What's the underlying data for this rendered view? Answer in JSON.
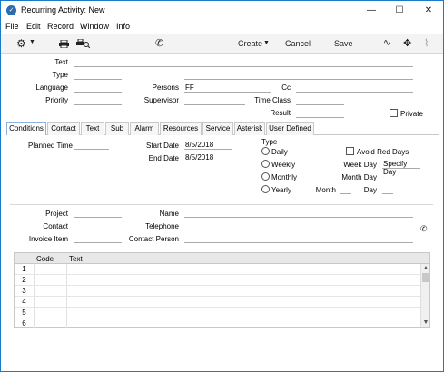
{
  "window": {
    "title": "Recurring Activity: New"
  },
  "menu": [
    "File",
    "Edit",
    "Record",
    "Window",
    "Info"
  ],
  "toolbar": {
    "create": "Create",
    "cancel": "Cancel",
    "save": "Save"
  },
  "form": {
    "text_label": "Text",
    "type_label": "Type",
    "language_label": "Language",
    "priority_label": "Priority",
    "persons_label": "Persons",
    "persons_value": "FF",
    "supervisor_label": "Supervisor",
    "cc_label": "Cc",
    "timeclass_label": "Time Class",
    "result_label": "Result",
    "private_label": "Private"
  },
  "tabs": [
    "Conditions",
    "Contact",
    "Text",
    "Sub",
    "Alarm",
    "Resources",
    "Service",
    "Asterisk",
    "User Defined"
  ],
  "conditions": {
    "planned_time_label": "Planned Time",
    "start_date_label": "Start Date",
    "start_date": "8/5/2018",
    "end_date_label": "End Date",
    "end_date": "8/5/2018",
    "type_label": "Type",
    "daily": "Daily",
    "weekly": "Weekly",
    "monthly": "Monthly",
    "yearly": "Yearly",
    "avoid_red_days": "Avoid Red Days",
    "week_day_label": "Week Day",
    "week_day_value": "Specify Day",
    "month_day_label": "Month Day",
    "month_label": "Month",
    "day_label": "Day"
  },
  "link": {
    "project_label": "Project",
    "contact_label": "Contact",
    "invoice_item_label": "Invoice Item",
    "name_label": "Name",
    "telephone_label": "Telephone",
    "contact_person_label": "Contact Person"
  },
  "grid": {
    "col_code": "Code",
    "col_text": "Text",
    "rows": [
      "1",
      "2",
      "3",
      "4",
      "5",
      "6"
    ]
  }
}
